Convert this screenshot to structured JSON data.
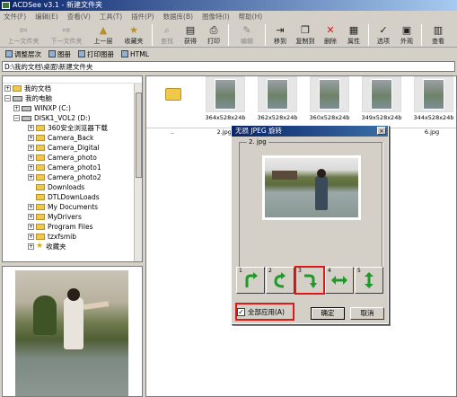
{
  "window": {
    "title": "ACDSee v3.1 - 新建文件夹"
  },
  "menu": [
    "文件(F)",
    "编辑(E)",
    "查看(V)",
    "工具(T)",
    "插件(P)",
    "数据库(B)",
    "图像特(I)",
    "帮助(H)"
  ],
  "toolbar": {
    "up_folder": "上一文件夹",
    "next_folder": "下一文件夹",
    "level_up": "上一层",
    "favorites": "收藏夹",
    "find": "查找",
    "acquire": "获得",
    "print": "打印",
    "edit": "编辑",
    "move": "移到",
    "copy": "复制到",
    "delete": "删除",
    "properties": "属性",
    "options": "选项",
    "appearance": "外观",
    "view": "查看"
  },
  "toolbar2": {
    "adjust": "调整层次",
    "album": "图册",
    "print_album": "打印图册",
    "html": "HTML"
  },
  "address": "D:\\我的文档\\桌面\\新建文件夹",
  "tree": {
    "items": [
      {
        "label": "我的文档",
        "kind": "folder"
      },
      {
        "label": "我的电脑",
        "kind": "computer"
      },
      {
        "label": "WINXP (C:)",
        "kind": "drive"
      },
      {
        "label": "DISK1_VOL2 (D:)",
        "kind": "drive"
      },
      {
        "label": "360安全浏览器下载",
        "kind": "folder"
      },
      {
        "label": "Camera_Back",
        "kind": "folder"
      },
      {
        "label": "Camera_Digital",
        "kind": "folder"
      },
      {
        "label": "Camera_photo",
        "kind": "folder"
      },
      {
        "label": "Camera_photo1",
        "kind": "folder"
      },
      {
        "label": "Camera_photo2",
        "kind": "folder"
      },
      {
        "label": "Downloads",
        "kind": "folder"
      },
      {
        "label": "DTLDownLoads",
        "kind": "folder"
      },
      {
        "label": "My Documents",
        "kind": "folder"
      },
      {
        "label": "MyDrivers",
        "kind": "folder"
      },
      {
        "label": "Program Files",
        "kind": "folder"
      },
      {
        "label": "tzxfsmib",
        "kind": "folder"
      },
      {
        "label": "收藏夹",
        "kind": "star"
      }
    ]
  },
  "files": {
    "thumbs": [
      {
        "caption": ""
      },
      {
        "caption": "364x528x24b"
      },
      {
        "caption": "362x528x24b"
      },
      {
        "caption": "360x528x24b"
      },
      {
        "caption": "349x528x24b"
      },
      {
        "caption": "344x528x24b"
      }
    ],
    "names": [
      "..",
      "2.jpg",
      "",
      "",
      "",
      "6.jpg"
    ]
  },
  "dialog": {
    "title": "无损 JPEG 旋转",
    "close": "×",
    "filename": "2. jpg",
    "rotate_buttons": [
      "1",
      "2",
      "3",
      "4",
      "5"
    ],
    "apply_all_label": "全部应用(A)",
    "apply_all_checked": "✓",
    "ok": "确定",
    "cancel": "取消"
  }
}
